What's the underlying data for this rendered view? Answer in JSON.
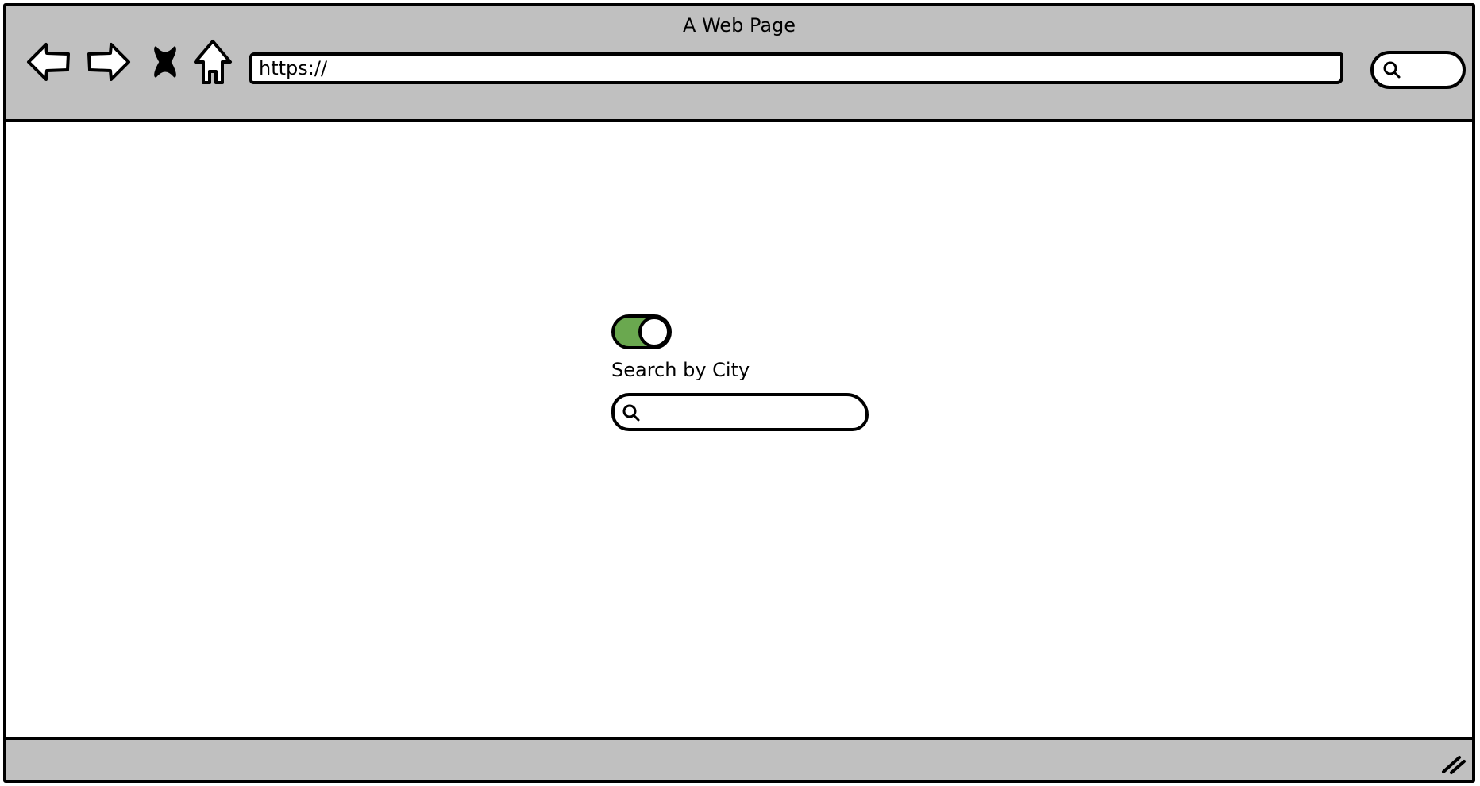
{
  "window": {
    "title": "A Web Page"
  },
  "toolbar": {
    "address_value": "https://",
    "icons": {
      "back": "back-arrow-icon",
      "forward": "forward-arrow-icon",
      "stop": "stop-x-icon",
      "home": "home-icon",
      "search": "search-icon"
    }
  },
  "main": {
    "toggle": {
      "state": "on",
      "on_color": "#6aa84f"
    },
    "search_label": "Search by City",
    "search_input_value": ""
  },
  "colors": {
    "chrome": "#c0c0c0",
    "content": "#ffffff",
    "outline": "#000000"
  }
}
